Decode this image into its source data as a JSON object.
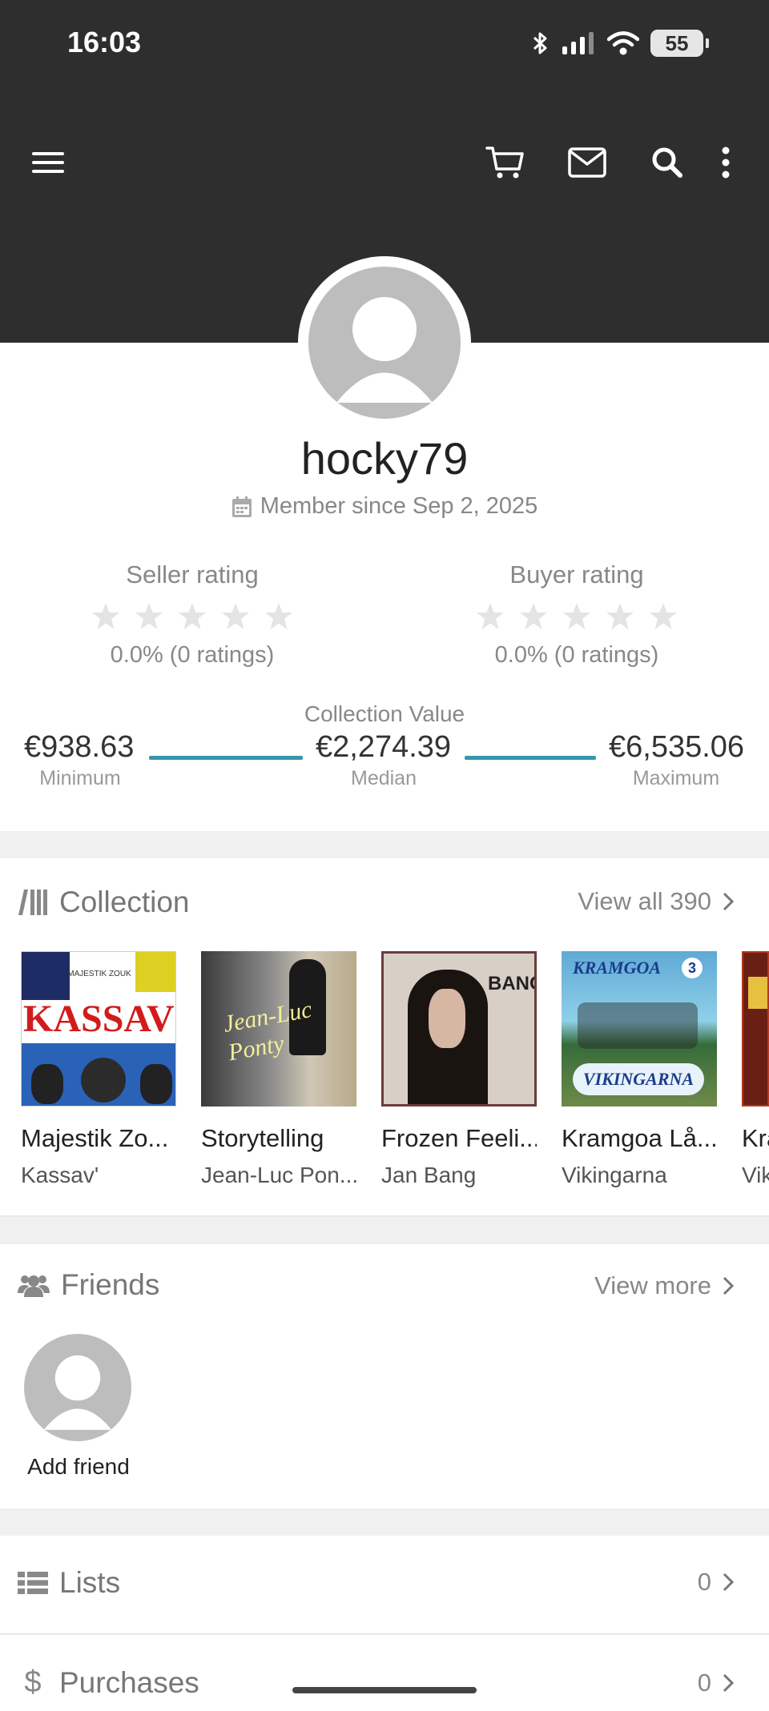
{
  "status_bar": {
    "time": "16:03",
    "battery": "55"
  },
  "header": {
    "menu_icon": "hamburger-icon",
    "cart_icon": "cart-icon",
    "mail_icon": "mail-icon",
    "search_icon": "search-icon",
    "more_icon": "more-vert-icon"
  },
  "profile": {
    "username": "hocky79",
    "member_since": "Member since Sep 2, 2025"
  },
  "ratings": {
    "seller": {
      "label": "Seller rating",
      "value": "0.0% (0 ratings)",
      "stars": 0
    },
    "buyer": {
      "label": "Buyer rating",
      "value": "0.0% (0 ratings)",
      "stars": 0
    }
  },
  "collection_value": {
    "title": "Collection Value",
    "minimum": {
      "value": "€938.63",
      "label": "Minimum"
    },
    "median": {
      "value": "€2,274.39",
      "label": "Median"
    },
    "maximum": {
      "value": "€6,535.06",
      "label": "Maximum"
    }
  },
  "collection": {
    "title": "Collection",
    "view_all": "View all 390",
    "items": [
      {
        "title": "Majestik Zo...",
        "artist": "Kassav'",
        "cover_text": "KASSAV'",
        "cover_top": "MAJESTIK ZOUK"
      },
      {
        "title": "Storytelling",
        "artist": "Jean-Luc Pon...",
        "cover_text": "Jean-Luc Ponty"
      },
      {
        "title": "Frozen Feeli...",
        "artist": "Jan Bang",
        "cover_text": "BANG"
      },
      {
        "title": "Kramgoa Lå...",
        "artist": "Vikingarna",
        "cover_text": "KRAMGOA",
        "cover_bottom": "VIKINGARNA",
        "cover_badge": "3"
      },
      {
        "title": "Kra",
        "artist": "Vik"
      }
    ]
  },
  "friends": {
    "title": "Friends",
    "view_more": "View more",
    "add_friend": "Add friend"
  },
  "lists": {
    "title": "Lists",
    "count": "0"
  },
  "purchases": {
    "title": "Purchases",
    "count": "0"
  },
  "colors": {
    "header_bg": "#2e2e2e",
    "accent": "#3696ad",
    "muted_text": "#888888"
  }
}
